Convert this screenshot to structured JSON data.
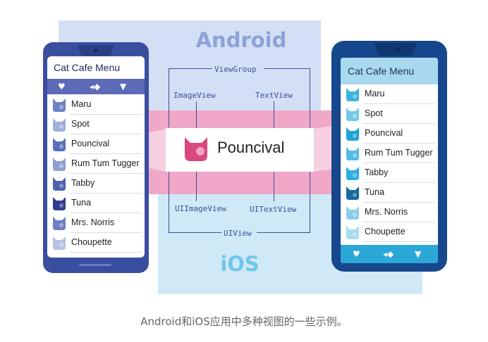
{
  "labels": {
    "android": "Android",
    "ios": "iOS",
    "viewgroup": "ViewGroup",
    "imageview": "ImageView",
    "textview": "TextView",
    "uiimageview": "UIImageView",
    "uitextview": "UITextView",
    "uiview": "UIView",
    "callout_text": "Pouncival"
  },
  "android": {
    "title": "Cat Cafe Menu",
    "tab_icons": [
      "heart-icon",
      "fish-icon",
      "cat-icon"
    ],
    "items": [
      "Maru",
      "Spot",
      "Pouncival",
      "Rum Tum Tugger",
      "Tabby",
      "Tuna",
      "Mrs. Norris",
      "Choupette"
    ],
    "colors": [
      "#6d82c4",
      "#9fb0dd",
      "#5a6fbe",
      "#8f9fd2",
      "#4e62b0",
      "#2f3f8f",
      "#6e7fc4",
      "#b6c2e6"
    ]
  },
  "ios": {
    "title": "Cat Cafe Menu",
    "tab_icons": [
      "heart-icon",
      "fish-icon",
      "cat-icon"
    ],
    "items": [
      "Maru",
      "Spot",
      "Pouncival",
      "Rum Tum Tugger",
      "Tabby",
      "Tuna",
      "Mrs. Norris",
      "Choupette"
    ],
    "colors": [
      "#3cb3dd",
      "#76c8e8",
      "#1fa3d6",
      "#54bde3",
      "#2eaee0",
      "#15699f",
      "#8dcfea",
      "#a8dbef"
    ]
  },
  "callout_icon_color": "#d84a7d",
  "caption": "Android和iOS应用中多种视图的一些示例。"
}
